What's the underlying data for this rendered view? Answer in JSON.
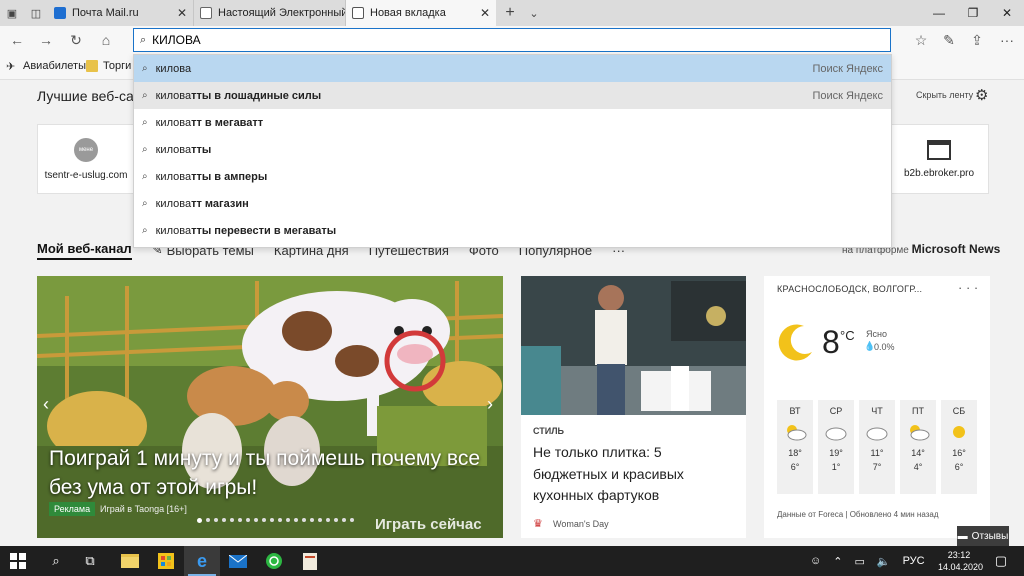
{
  "tabs": [
    {
      "label": "Почта Mail.ru",
      "color": "#1f6fd1"
    },
    {
      "label": "Настоящий Электронный Е",
      "color": "#666666"
    },
    {
      "label": "Новая вкладка",
      "color": "#555555",
      "active": true
    }
  ],
  "address": {
    "value": "КИЛОВА"
  },
  "favorites": [
    {
      "label": "Авиабилеты"
    },
    {
      "label": "Торги"
    }
  ],
  "page": {
    "best_sites": "Лучшие веб-сайт",
    "hide_feed": "Скрыть ленту",
    "sites": [
      {
        "label": "tsentr-e-uslug.com",
        "logo": "мене"
      },
      {
        "label": "b2b.ebroker.pro"
      }
    ]
  },
  "feed_nav": {
    "items": [
      "Мой веб-канал",
      "Выбрать темы",
      "Картина дня",
      "Путешествия",
      "Фото",
      "Популярное",
      "···"
    ],
    "powered_prefix": "на платформе",
    "powered_brand": "Microsoft News"
  },
  "big_card": {
    "title": "Поиграй 1 минуту и ты поймешь почему все без ума от этой игры!",
    "badge": "Реклама",
    "source": "Играй в Taonga [16+]",
    "cta": "Играть сейчас"
  },
  "article": {
    "category": "СТИЛЬ",
    "title": "Не только плитка: 5 бюджетных и красивых кухонных фартуков",
    "source": "Woman's Day"
  },
  "weather": {
    "location": "КРАСНОСЛОБОДСК, ВОЛГОГР...",
    "more": "· · ·",
    "temp": "8",
    "unit": "°C",
    "condition": "Ясно",
    "precip": "0.0%",
    "days": [
      {
        "name": "ВТ",
        "hi": "18°",
        "lo": "6°",
        "icon": "partly-cloudy-icon"
      },
      {
        "name": "СР",
        "hi": "19°",
        "lo": "1°",
        "icon": "cloudy-icon"
      },
      {
        "name": "ЧТ",
        "hi": "11°",
        "lo": "7°",
        "icon": "cloudy-icon"
      },
      {
        "name": "ПТ",
        "hi": "14°",
        "lo": "4°",
        "icon": "partly-cloudy-icon"
      },
      {
        "name": "СБ",
        "hi": "16°",
        "lo": "6°",
        "icon": "sun-icon"
      }
    ],
    "footer": "Данные от Foreca | Обновлено 4 мин назад"
  },
  "feedback": "Отзывы",
  "suggestions": [
    {
      "prefix": "килова",
      "rest": "",
      "engine": "Поиск Яндекс"
    },
    {
      "prefix": "килова",
      "rest": "тты в лошадиные силы",
      "engine": "Поиск Яндекс"
    },
    {
      "prefix": "килова",
      "rest": "тт в мегаватт",
      "engine": ""
    },
    {
      "prefix": "килова",
      "rest": "тты",
      "engine": ""
    },
    {
      "prefix": "килова",
      "rest": "тты в амперы",
      "engine": ""
    },
    {
      "prefix": "килова",
      "rest": "тт магазин",
      "engine": ""
    },
    {
      "prefix": "килова",
      "rest": "тты перевести в мегаваты",
      "engine": ""
    }
  ],
  "taskbar": {
    "lang": "РУС",
    "time": "23:12",
    "date": "14.04.2020"
  },
  "colors": {
    "accent": "#1a73c9",
    "taskbar": "#1f1f1f",
    "selection": "#b9d7f0"
  }
}
